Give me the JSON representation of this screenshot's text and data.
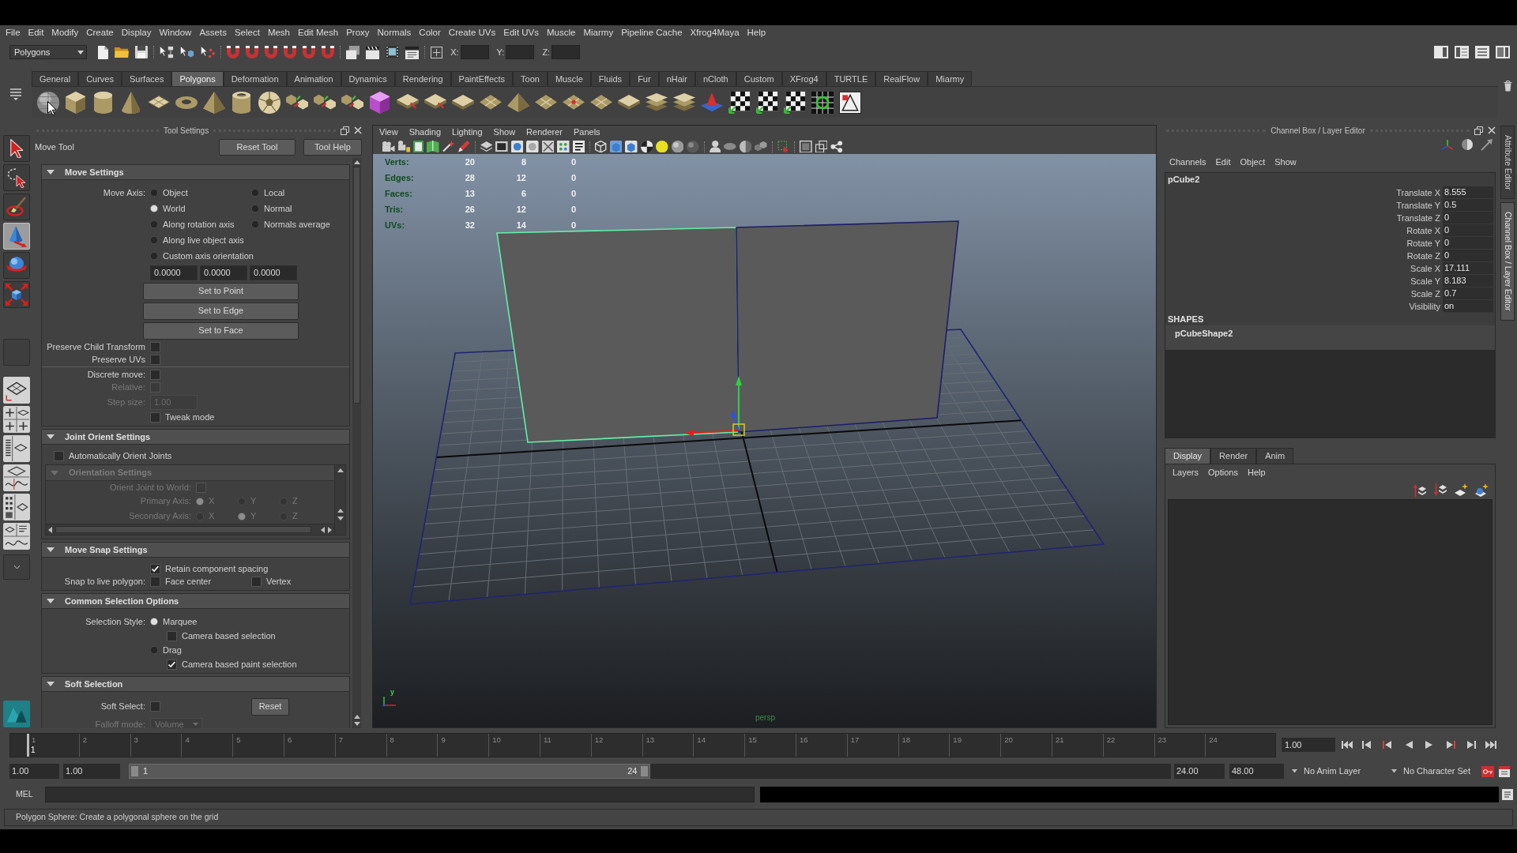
{
  "menu_bar": [
    "File",
    "Edit",
    "Modify",
    "Create",
    "Display",
    "Window",
    "Assets",
    "Select",
    "Mesh",
    "Edit Mesh",
    "Proxy",
    "Normals",
    "Color",
    "Create UVs",
    "Edit UVs",
    "Muscle",
    "Miarmy",
    "Pipeline Cache",
    "Xfrog4Maya",
    "Help"
  ],
  "status_line": {
    "menu_set": "Polygons",
    "coordinate_labels": [
      "X:",
      "Y:",
      "Z:"
    ]
  },
  "shelf": {
    "tabs": [
      {
        "label": "General",
        "selected": false
      },
      {
        "label": "Curves",
        "selected": false
      },
      {
        "label": "Surfaces",
        "selected": false
      },
      {
        "label": "Polygons",
        "selected": true
      },
      {
        "label": "Deformation",
        "selected": false
      },
      {
        "label": "Animation",
        "selected": false
      },
      {
        "label": "Dynamics",
        "selected": false
      },
      {
        "label": "Rendering",
        "selected": false
      },
      {
        "label": "PaintEffects",
        "selected": false
      },
      {
        "label": "Toon",
        "selected": false
      },
      {
        "label": "Muscle",
        "selected": false
      },
      {
        "label": "Fluids",
        "selected": false
      },
      {
        "label": "Fur",
        "selected": false
      },
      {
        "label": "nHair",
        "selected": false
      },
      {
        "label": "nCloth",
        "selected": false
      },
      {
        "label": "Custom",
        "selected": false
      },
      {
        "label": "XFrog4",
        "selected": false
      },
      {
        "label": "TURTLE",
        "selected": false
      },
      {
        "label": "RealFlow",
        "selected": false
      },
      {
        "label": "Miarmy",
        "selected": false
      }
    ]
  },
  "toolbox": [
    {
      "selected": false
    },
    {
      "selected": false
    },
    {
      "selected": false
    },
    {
      "selected": true
    },
    {
      "selected": false
    },
    {
      "selected": false
    }
  ],
  "tool_settings": {
    "title": "Tool Settings",
    "tool_name": "Move Tool",
    "buttons": [
      "Reset Tool",
      "Tool Help"
    ],
    "sections": [
      {
        "title": "Move Settings",
        "expanded": true,
        "rows": [
          {
            "kind": "standard",
            "disabled": false,
            "label": "Move Axis:",
            "controls": [
              {
                "kind": "radio",
                "label": "Object",
                "selected": false
              },
              {
                "kind": "radio",
                "label": "Local",
                "selected": false
              }
            ]
          },
          {
            "kind": "standard",
            "disabled": false,
            "controls": [
              {
                "kind": "radio",
                "label": "World",
                "selected": true
              },
              {
                "kind": "radio",
                "label": "Normal",
                "selected": false
              }
            ]
          },
          {
            "kind": "standard",
            "disabled": false,
            "controls": [
              {
                "kind": "radio",
                "label": "Along rotation axis",
                "selected": false
              },
              {
                "kind": "radio",
                "label": "Normals average",
                "selected": false
              }
            ]
          },
          {
            "kind": "standard",
            "disabled": false,
            "controls": [
              {
                "kind": "radio",
                "label": "Along live object axis",
                "selected": false
              }
            ]
          },
          {
            "kind": "standard",
            "disabled": false,
            "controls": [
              {
                "kind": "radio",
                "label": "Custom axis orientation",
                "selected": false
              }
            ]
          },
          {
            "kind": "standard",
            "disabled": false,
            "controls": [
              {
                "kind": "field",
                "value": "0.0000"
              },
              {
                "kind": "field",
                "value": "0.0000"
              },
              {
                "kind": "field",
                "value": "0.0000"
              }
            ]
          },
          {
            "kind": "standard",
            "disabled": false,
            "controls": [
              {
                "kind": "button",
                "label": "Set to Point"
              }
            ]
          },
          {
            "kind": "standard",
            "disabled": false,
            "controls": [
              {
                "kind": "button",
                "label": "Set to Edge"
              }
            ]
          },
          {
            "kind": "standard",
            "disabled": false,
            "controls": [
              {
                "kind": "button",
                "label": "Set to Face"
              }
            ]
          },
          {
            "kind": "standard",
            "disabled": false,
            "label": "Preserve Child Transform",
            "controls": [
              {
                "kind": "checkbox",
                "checked": false
              }
            ]
          },
          {
            "kind": "standard",
            "disabled": false,
            "label": "Preserve UVs",
            "controls": [
              {
                "kind": "checkbox",
                "checked": false
              }
            ]
          },
          {
            "kind": "divider"
          },
          {
            "kind": "standard",
            "disabled": false,
            "label": "Discrete move:",
            "controls": [
              {
                "kind": "checkbox",
                "checked": false
              }
            ]
          },
          {
            "kind": "standard",
            "disabled": true,
            "label": "Relative:",
            "controls": [
              {
                "kind": "checkbox",
                "checked": false
              }
            ]
          },
          {
            "kind": "standard",
            "disabled": true,
            "label": "Step size:",
            "controls": [
              {
                "kind": "field",
                "value": "1.00"
              }
            ]
          },
          {
            "kind": "standard",
            "disabled": false,
            "controls": [
              {
                "kind": "checkbox",
                "label": "Tweak mode",
                "checked": false
              }
            ]
          }
        ]
      },
      {
        "title": "Joint Orient Settings",
        "expanded": true,
        "rows": [
          {
            "kind": "wide",
            "disabled": false,
            "controls": [
              {
                "kind": "checkbox",
                "label": "Automatically Orient Joints",
                "checked": false
              }
            ]
          },
          {
            "kind": "group",
            "title": "Orientation Settings",
            "expanded": true,
            "disabled": true,
            "rows": [
              {
                "kind": "standard",
                "disabled": true,
                "label": "Orient Joint to World:",
                "controls": [
                  {
                    "kind": "checkbox",
                    "checked": false
                  }
                ]
              },
              {
                "kind": "standard",
                "disabled": true,
                "label": "Primary Axis:",
                "controls": [
                  {
                    "kind": "radio",
                    "label": "X",
                    "selected": true
                  },
                  {
                    "kind": "radio",
                    "label": "Y",
                    "selected": false
                  },
                  {
                    "kind": "radio",
                    "label": "Z",
                    "selected": false
                  }
                ]
              },
              {
                "kind": "standard",
                "disabled": true,
                "label": "Secondary Axis:",
                "controls": [
                  {
                    "kind": "radio",
                    "label": "X",
                    "selected": false
                  },
                  {
                    "kind": "radio",
                    "label": "Y",
                    "selected": true
                  },
                  {
                    "kind": "radio",
                    "label": "Z",
                    "selected": false
                  }
                ]
              }
            ]
          }
        ]
      },
      {
        "title": "Move Snap Settings",
        "expanded": true,
        "rows": [
          {
            "kind": "standard",
            "disabled": false,
            "controls": [
              {
                "kind": "checkbox",
                "label": "Retain component spacing",
                "checked": true
              }
            ]
          },
          {
            "kind": "standard",
            "disabled": false,
            "label": "Snap to live polygon:",
            "controls": [
              {
                "kind": "checkbox",
                "label": "Face center",
                "checked": false
              },
              {
                "kind": "checkbox",
                "label": "Vertex",
                "checked": false
              }
            ]
          }
        ]
      },
      {
        "title": "Common Selection Options",
        "expanded": true,
        "rows": [
          {
            "kind": "standard",
            "disabled": false,
            "label": "Selection Style:",
            "controls": [
              {
                "kind": "radio",
                "label": "Marquee",
                "selected": true
              }
            ]
          },
          {
            "kind": "nested",
            "disabled": false,
            "controls": [
              {
                "kind": "checkbox",
                "label": "Camera based selection",
                "checked": false
              }
            ]
          },
          {
            "kind": "standard",
            "disabled": false,
            "controls": [
              {
                "kind": "radio",
                "label": "Drag",
                "selected": false
              }
            ]
          },
          {
            "kind": "nested",
            "disabled": false,
            "controls": [
              {
                "kind": "checkbox",
                "label": "Camera based paint selection",
                "checked": true
              }
            ]
          }
        ]
      },
      {
        "title": "Soft Selection",
        "expanded": true,
        "rows": [
          {
            "kind": "standard",
            "disabled": false,
            "label": "Soft Select:",
            "controls": [
              {
                "kind": "checkbox",
                "checked": false
              },
              {
                "kind": "button",
                "label": "Reset"
              }
            ]
          },
          {
            "kind": "standard",
            "disabled": true,
            "label": "Falloff mode:",
            "controls": [
              {
                "kind": "dropdown",
                "value": "Volume"
              }
            ]
          }
        ]
      }
    ]
  },
  "viewport": {
    "menu": [
      "View",
      "Shading",
      "Lighting",
      "Show",
      "Renderer",
      "Panels"
    ],
    "stats": [
      {
        "label": "Verts:",
        "values": [
          "20",
          "8",
          "0"
        ]
      },
      {
        "label": "Edges:",
        "values": [
          "28",
          "12",
          "0"
        ]
      },
      {
        "label": "Faces:",
        "values": [
          "13",
          "6",
          "0"
        ]
      },
      {
        "label": "Tris:",
        "values": [
          "26",
          "12",
          "0"
        ]
      },
      {
        "label": "UVs:",
        "values": [
          "32",
          "14",
          "0"
        ]
      }
    ],
    "meshes": [
      {
        "selected": true
      },
      {
        "selected": false
      }
    ],
    "camera": "persp",
    "axis_gizmo": {
      "label": "y"
    }
  },
  "channel_box": {
    "title": "Channel Box / Layer Editor",
    "menu": [
      "Channels",
      "Edit",
      "Object",
      "Show"
    ],
    "object": "pCube2",
    "channels": [
      {
        "name": "Translate X",
        "value": "8.555"
      },
      {
        "name": "Translate Y",
        "value": "0.5"
      },
      {
        "name": "Translate Z",
        "value": "0"
      },
      {
        "name": "Rotate X",
        "value": "0"
      },
      {
        "name": "Rotate Y",
        "value": "0"
      },
      {
        "name": "Rotate Z",
        "value": "0"
      },
      {
        "name": "Scale X",
        "value": "17.111"
      },
      {
        "name": "Scale Y",
        "value": "8.183"
      },
      {
        "name": "Scale Z",
        "value": "0.7"
      },
      {
        "name": "Visibility",
        "value": "on"
      }
    ],
    "shapes_heading": "SHAPES",
    "shapes": [
      "pCubeShape2"
    ]
  },
  "side_tabs": [
    {
      "label": "Attribute Editor",
      "selected": false
    },
    {
      "label": "Channel Box / Layer Editor",
      "selected": true
    }
  ],
  "layer_editor": {
    "tabs": [
      {
        "label": "Display",
        "selected": true
      },
      {
        "label": "Render",
        "selected": false
      },
      {
        "label": "Anim",
        "selected": false
      }
    ],
    "menu": [
      "Layers",
      "Options",
      "Help"
    ]
  },
  "time_slider": {
    "ticks": [
      "1",
      "2",
      "3",
      "4",
      "5",
      "6",
      "7",
      "8",
      "9",
      "10",
      "11",
      "12",
      "13",
      "14",
      "15",
      "16",
      "17",
      "18",
      "19",
      "20",
      "21",
      "22",
      "23",
      "24"
    ],
    "playhead": {
      "label": "1",
      "level": 0
    },
    "current_time": "1.00"
  },
  "range_slider": {
    "start_time": "1.00",
    "playback_start": "1.00",
    "range_start": "1",
    "range_end": "24",
    "level": 0.5,
    "playback_end": "24.00",
    "end_time": "48.00",
    "anim_layer": "No Anim Layer",
    "character_set": "No Character Set"
  },
  "command_line": {
    "language": "MEL"
  },
  "help_line": "Polygon Sphere: Create a polygonal sphere on the grid"
}
